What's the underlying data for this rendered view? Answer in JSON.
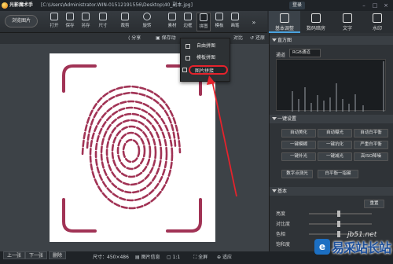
{
  "titlebar": {
    "app_name": "光影魔术手",
    "path": "[C:\\Users\\Administrator.WIN-01512191556\\Desktop\\40_副本.jpg]",
    "login": "登录"
  },
  "toolbar": {
    "browse_label": "浏览图片",
    "buttons": [
      {
        "label": "打开",
        "icon": "folder-icon"
      },
      {
        "label": "保存",
        "icon": "save-icon"
      },
      {
        "label": "另存",
        "icon": "save-as-icon"
      },
      {
        "label": "尺寸",
        "icon": "resize-icon"
      },
      {
        "label": "裁剪",
        "icon": "crop-icon"
      },
      {
        "label": "旋转",
        "icon": "rotate-icon"
      },
      {
        "label": "素材",
        "icon": "sticker-icon"
      },
      {
        "label": "边框",
        "icon": "frame-icon"
      },
      {
        "label": "拼图",
        "icon": "collage-icon"
      },
      {
        "label": "模板",
        "icon": "template-icon"
      },
      {
        "label": "画笔",
        "icon": "brush-icon"
      }
    ],
    "more": "»"
  },
  "right_tabs": [
    {
      "label": "基本调整",
      "icon": "adjust-icon"
    },
    {
      "label": "数码暗房",
      "icon": "darkroom-icon"
    },
    {
      "label": "文字",
      "icon": "text-icon"
    },
    {
      "label": "水印",
      "icon": "watermark-icon"
    }
  ],
  "subbar": {
    "share": "分享",
    "save_as": "保存动",
    "compare": "对比",
    "restore": "还原"
  },
  "dropdown": {
    "items": [
      "自由拼图",
      "模板拼图",
      "图片拼接"
    ],
    "highlighted_index": 2,
    "highlight_color": "#e5232c"
  },
  "panel": {
    "histogram_title": "直方图",
    "channel_label": "通道",
    "channel_value": "RGB通道",
    "oneclick_title": "一键设置",
    "oneclick_buttons": [
      "自动美化",
      "自动曝光",
      "自动白平衡",
      "一键模糊",
      "一键抗化",
      "严重白平衡",
      "一键补光",
      "一键减光",
      "高ISO降噪",
      "数字点测光",
      "白平衡一指键"
    ],
    "basic_title": "基本",
    "reset_label": "重置",
    "rows": [
      "亮度",
      "对比度",
      "色相",
      "饱和度"
    ]
  },
  "statusbar": {
    "prev": "上一张",
    "next": "下一张",
    "delete": "删除",
    "size": "尺寸：450×486",
    "info": "图片信息",
    "ratio": "1:1",
    "fullscreen": "全屏",
    "zoom": "适应"
  },
  "watermark": {
    "site": "易采站长站",
    "url": "jb51.net"
  },
  "colors": {
    "fingerprint": "#a13355",
    "accent_red": "#e5232c",
    "tab_accent": "#4aa3df"
  }
}
